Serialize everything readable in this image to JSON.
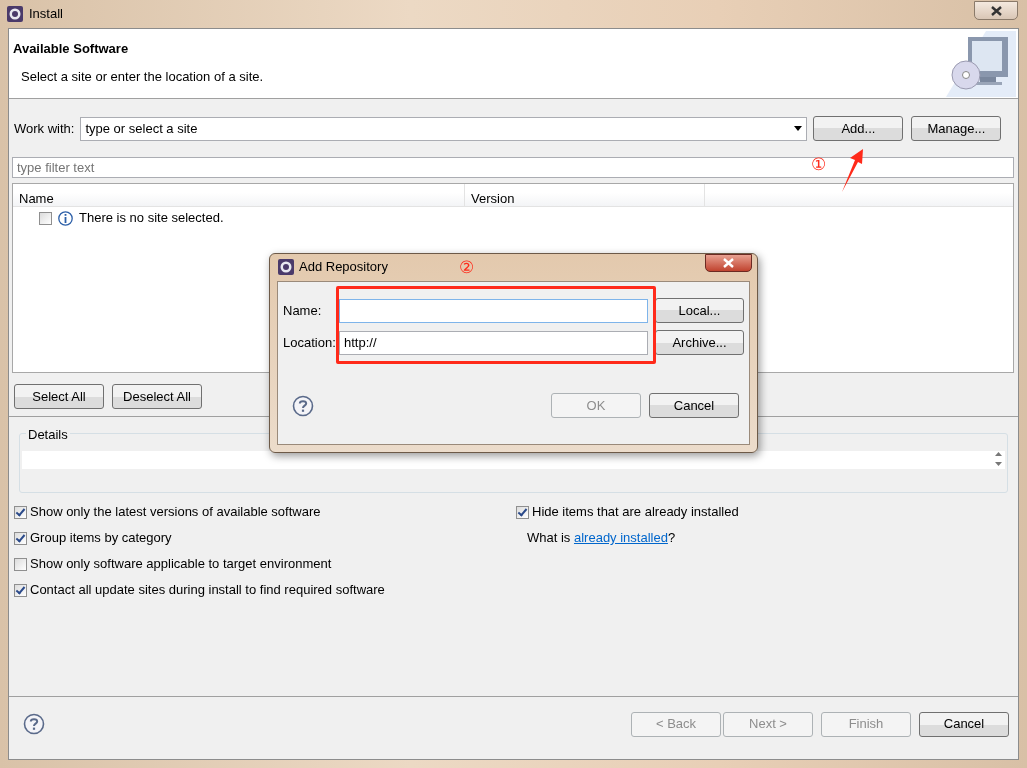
{
  "window": {
    "title": "Install"
  },
  "header": {
    "title": "Available Software",
    "subtitle": "Select a site or enter the location of a site."
  },
  "work_with": {
    "label": "Work with:",
    "value": "type or select a site"
  },
  "site_buttons": [
    "Add...",
    "Manage..."
  ],
  "filter": {
    "placeholder": "type filter text"
  },
  "table": {
    "columns": [
      "Name",
      "Version"
    ],
    "rows": [
      {
        "checked": false,
        "text": "There is no site selected."
      }
    ]
  },
  "selection_buttons": [
    "Select All",
    "Deselect All"
  ],
  "details": {
    "label": "Details"
  },
  "options_left": [
    {
      "label": "Show only the latest versions of available software",
      "checked": true
    },
    {
      "label": "Group items by category",
      "checked": true
    },
    {
      "label": "Show only software applicable to target environment",
      "checked": false
    },
    {
      "label": "Contact all update sites during install to find required software",
      "checked": true
    }
  ],
  "options_right": [
    {
      "label": "Hide items that are already installed",
      "checked": true
    }
  ],
  "installed_note": {
    "prefix": "What is ",
    "link": "already installed",
    "suffix": "?"
  },
  "footer_buttons": [
    {
      "label": "< Back",
      "disabled": true
    },
    {
      "label": "Next >",
      "disabled": true
    },
    {
      "label": "Finish",
      "disabled": true
    },
    {
      "label": "Cancel",
      "disabled": false
    }
  ],
  "dialog": {
    "title": "Add Repository",
    "fields": [
      {
        "label": "Name:",
        "button": "Local..."
      },
      {
        "label": "Location:",
        "value": "http://",
        "button": "Archive..."
      }
    ],
    "buttons": [
      {
        "label": "OK",
        "disabled": true
      },
      {
        "label": "Cancel",
        "disabled": false
      }
    ]
  },
  "annotations": [
    {
      "text": "①"
    },
    {
      "text": "②"
    }
  ]
}
